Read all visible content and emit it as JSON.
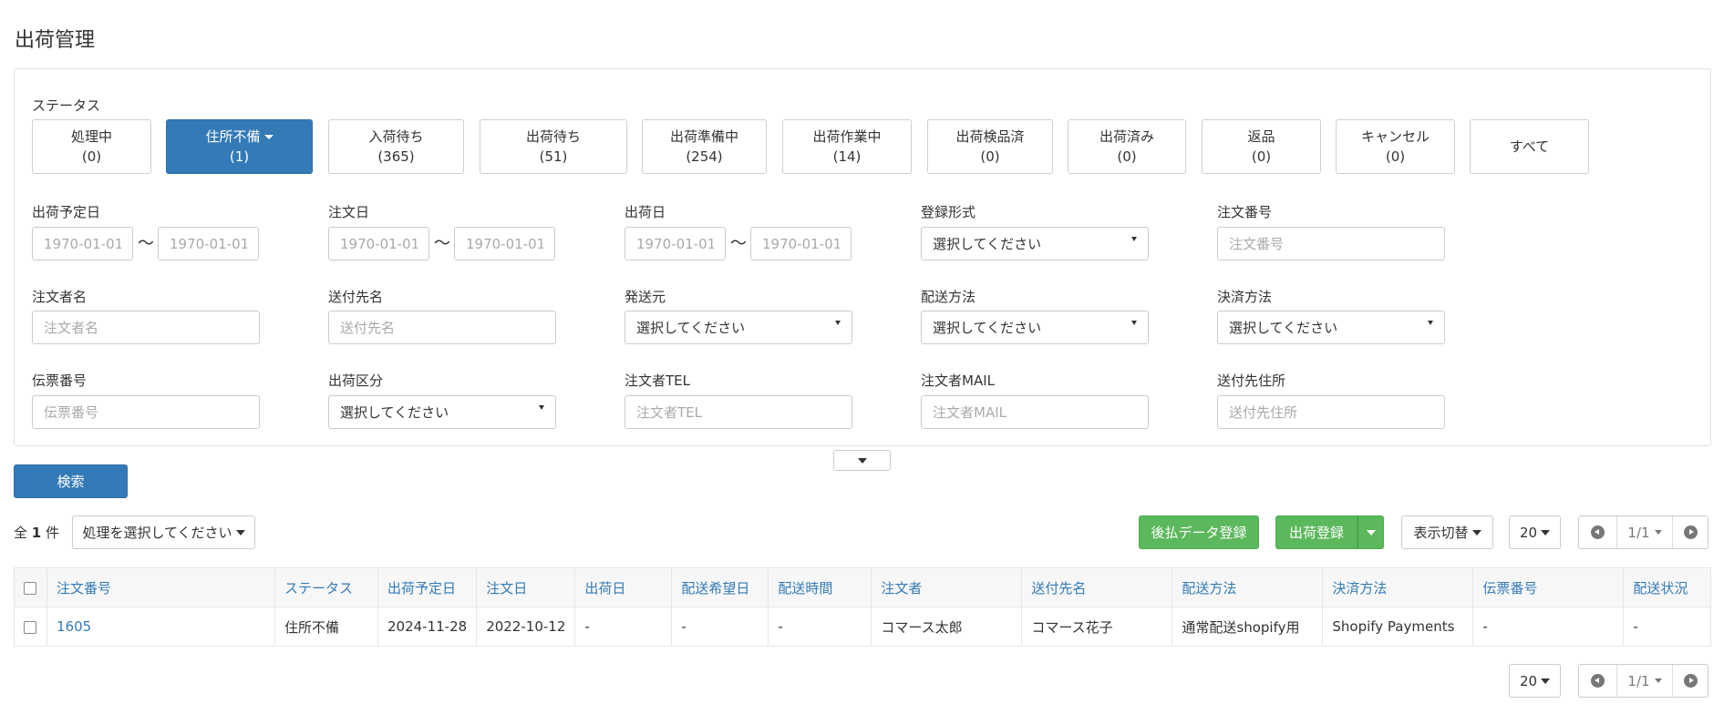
{
  "page": {
    "title": "出荷管理"
  },
  "status": {
    "label": "ステータス",
    "buttons": [
      {
        "name": "処理中",
        "count": "(0)"
      },
      {
        "name": "住所不備",
        "count": "(1)"
      },
      {
        "name": "入荷待ち",
        "count": "(365)"
      },
      {
        "name": "出荷待ち",
        "count": "(51)"
      },
      {
        "name": "出荷準備中",
        "count": "(254)"
      },
      {
        "name": "出荷作業中",
        "count": "(14)"
      },
      {
        "name": "出荷検品済",
        "count": "(0)"
      },
      {
        "name": "出荷済み",
        "count": "(0)"
      },
      {
        "name": "返品",
        "count": "(0)"
      },
      {
        "name": "キャンセル",
        "count": "(0)"
      },
      {
        "name": "すべて",
        "count": ""
      }
    ]
  },
  "filters": {
    "ship_date": {
      "label": "出荷予定日",
      "from_placeholder": "1970-01-01",
      "to_placeholder": "1970-01-01"
    },
    "order_date": {
      "label": "注文日",
      "from_placeholder": "1970-01-01",
      "to_placeholder": "1970-01-01"
    },
    "shipped_date": {
      "label": "出荷日",
      "from_placeholder": "1970-01-01",
      "to_placeholder": "1970-01-01"
    },
    "reg_type": {
      "label": "登録形式",
      "value": "選択してください"
    },
    "order_no": {
      "label": "注文番号",
      "placeholder": "注文番号"
    },
    "orderer_name": {
      "label": "注文者名",
      "placeholder": "注文者名"
    },
    "dest_name": {
      "label": "送付先名",
      "placeholder": "送付先名"
    },
    "origin": {
      "label": "発送元",
      "value": "選択してください"
    },
    "delivery_method": {
      "label": "配送方法",
      "value": "選択してください"
    },
    "payment_method": {
      "label": "決済方法",
      "value": "選択してください"
    },
    "slip_no": {
      "label": "伝票番号",
      "placeholder": "伝票番号"
    },
    "ship_class": {
      "label": "出荷区分",
      "value": "選択してください"
    },
    "orderer_tel": {
      "label": "注文者TEL",
      "placeholder": "注文者TEL"
    },
    "orderer_mail": {
      "label": "注文者MAIL",
      "placeholder": "注文者MAIL"
    },
    "dest_address": {
      "label": "送付先住所",
      "placeholder": "送付先住所"
    },
    "tilde": "〜"
  },
  "actions": {
    "search": "検索",
    "total_prefix": "全",
    "total_count": "1",
    "total_suffix": "件",
    "bulk_select": "処理を選択してください",
    "deferred_payment": "後払データ登録",
    "register_shipment": "出荷登録",
    "view_toggle": "表示切替",
    "per_page": "20",
    "page_info": "1/1"
  },
  "table": {
    "headers": [
      "注文番号",
      "ステータス",
      "出荷予定日",
      "注文日",
      "出荷日",
      "配送希望日",
      "配送時間",
      "注文者",
      "送付先名",
      "配送方法",
      "決済方法",
      "伝票番号",
      "配送状況"
    ],
    "rows": [
      [
        "1605",
        "住所不備",
        "2024-11-28",
        "2022-10-12",
        "-",
        "-",
        "-",
        "コマース太郎",
        "コマース花子",
        "通常配送shopify用",
        "Shopify Payments",
        "-",
        "-"
      ]
    ]
  },
  "colors": {
    "primary": "#337ab7",
    "success": "#5cb85c",
    "border": "#cccccc"
  }
}
